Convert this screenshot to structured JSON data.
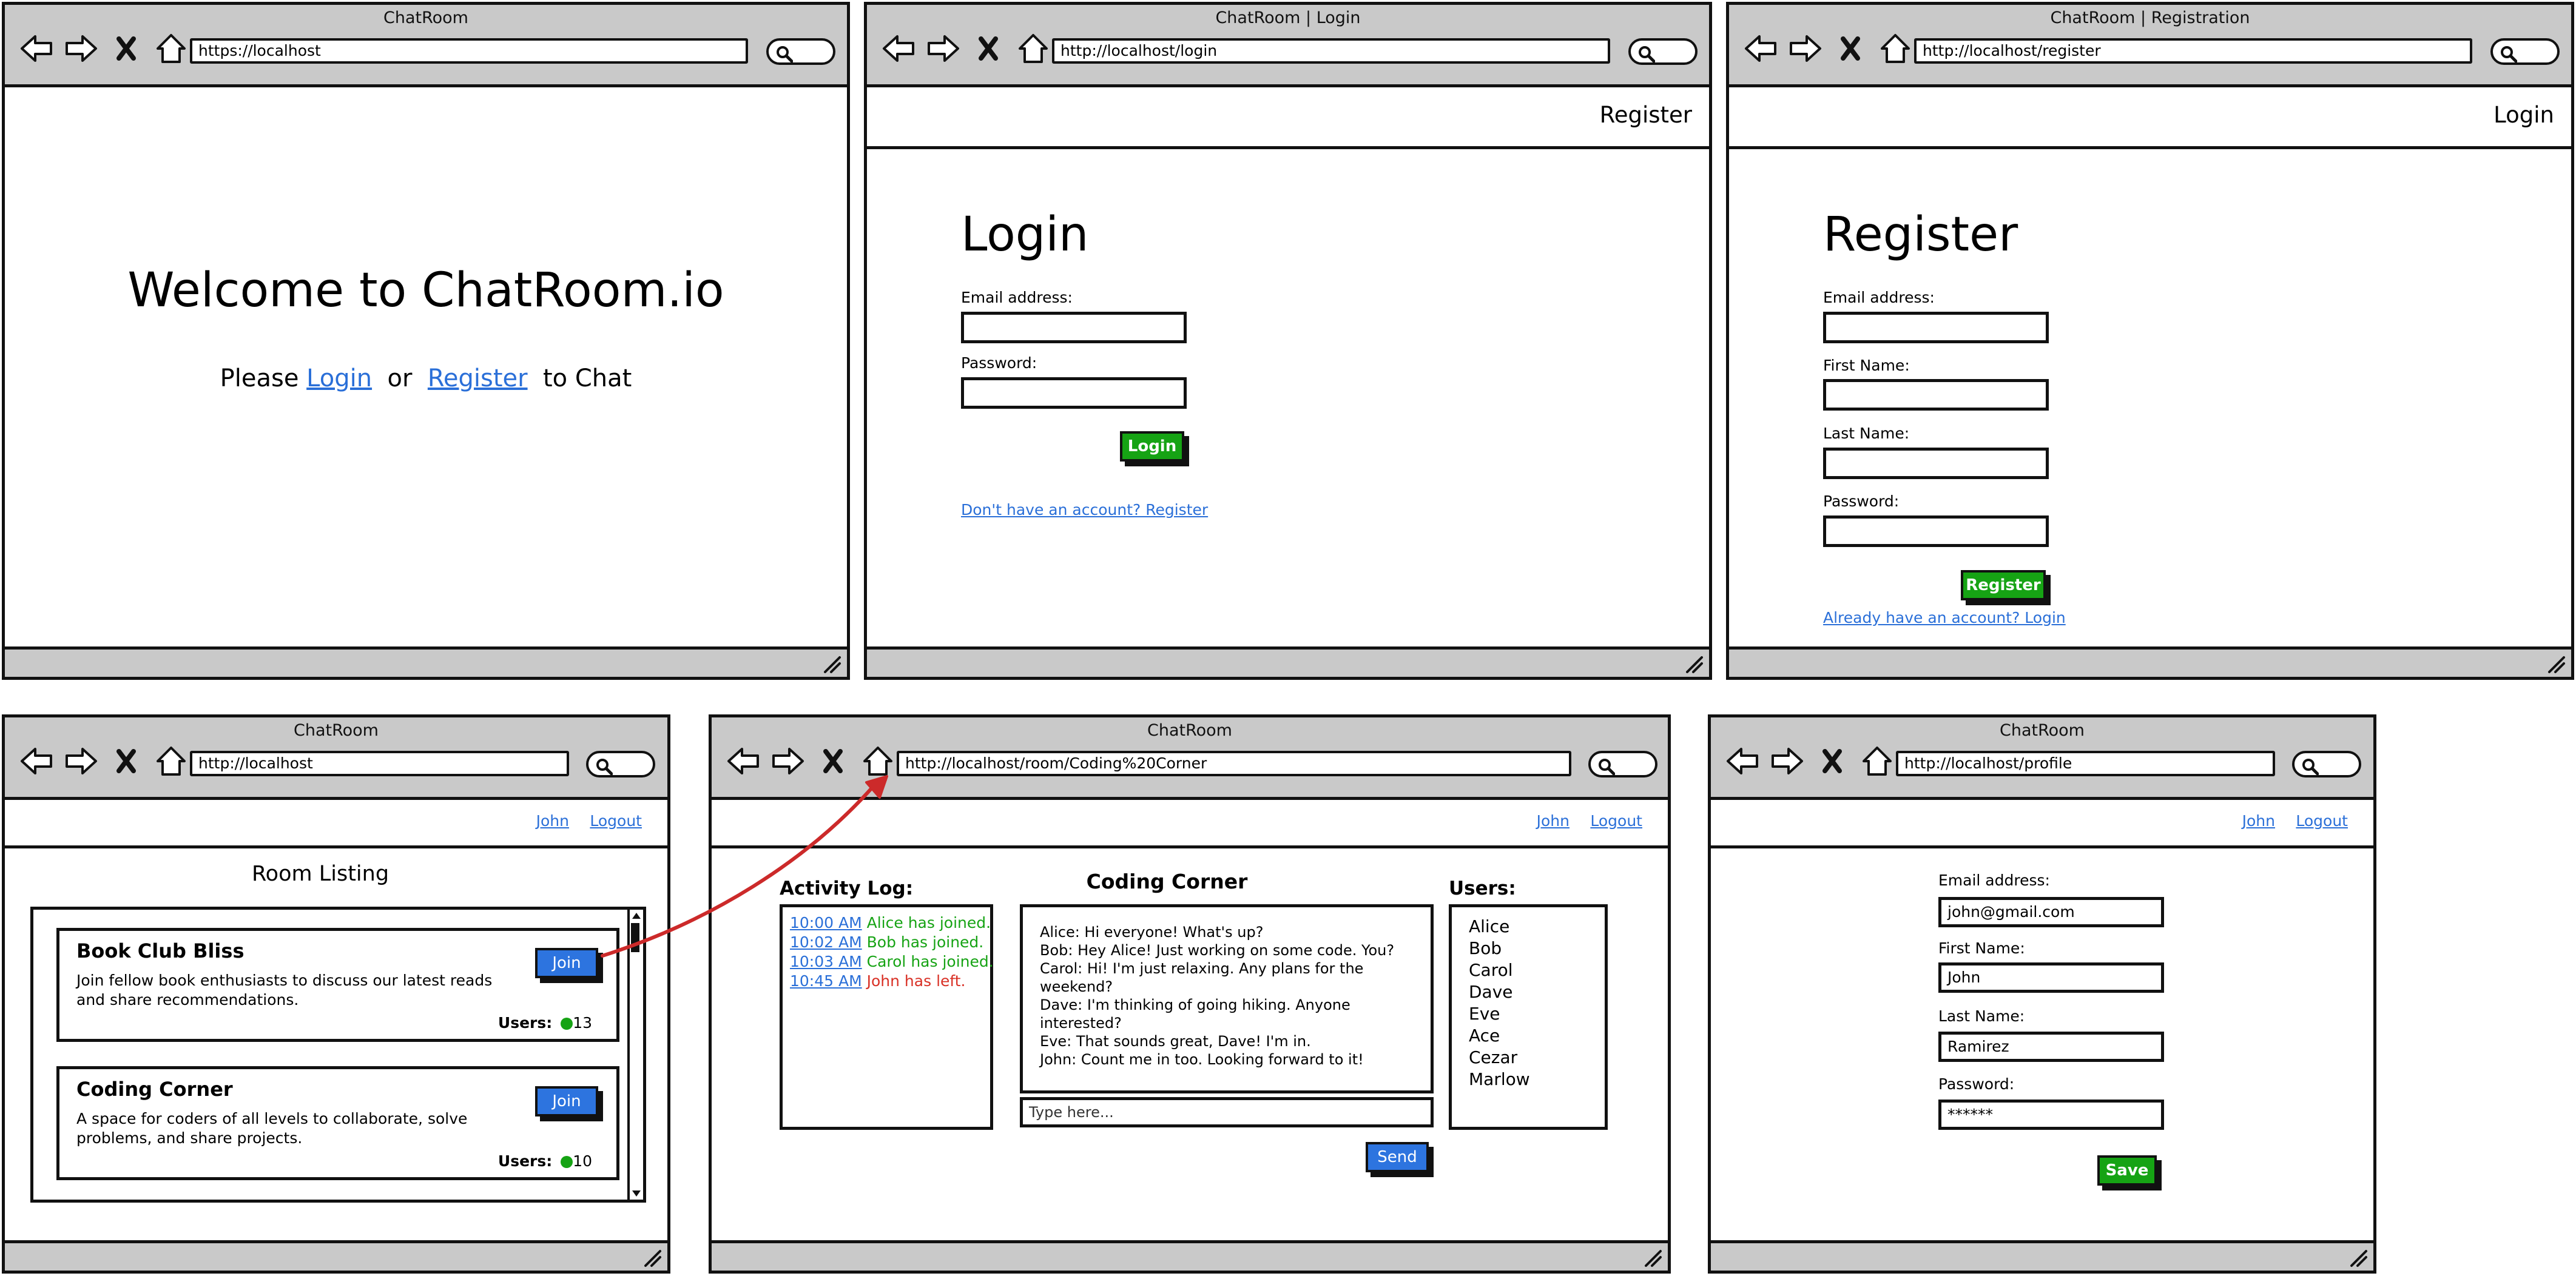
{
  "windows": {
    "welcome": {
      "title": "ChatRoom",
      "url": "https://localhost",
      "heading": "Welcome to ChatRoom.io",
      "prompt_please": "Please",
      "login_link": "Login",
      "prompt_or": "or",
      "register_link": "Register",
      "prompt_end": "to Chat"
    },
    "login": {
      "title": "ChatRoom | Login",
      "url": "http://localhost/login",
      "nav_register": "Register",
      "heading": "Login",
      "email_label": "Email address:",
      "password_label": "Password:",
      "login_button": "Login",
      "register_link": "Don't have an account? Register"
    },
    "register": {
      "title": "ChatRoom | Registration",
      "url": "http://localhost/register",
      "nav_login": "Login",
      "heading": "Register",
      "email_label": "Email address:",
      "first_name_label": "First Name:",
      "last_name_label": "Last Name:",
      "password_label": "Password:",
      "register_button": "Register",
      "login_link": "Already have an account? Login"
    },
    "rooms": {
      "title": "ChatRoom",
      "url": "http://localhost",
      "nav_user": "John",
      "nav_logout": "Logout",
      "heading": "Room Listing",
      "users_label": "Users:",
      "join_label": "Join",
      "cards": [
        {
          "title": "Book Club Bliss",
          "description": "Join fellow book enthusiasts to discuss our latest reads and share recommendations.",
          "count": "13"
        },
        {
          "title": "Coding Corner",
          "description": "A space for coders of all levels to collaborate, solve problems, and share projects.",
          "count": "10"
        }
      ]
    },
    "chat": {
      "title": "ChatRoom",
      "url": "http://localhost/room/Coding%20Corner",
      "nav_user": "John",
      "nav_logout": "Logout",
      "room_title": "Coding Corner",
      "activity_heading": "Activity Log:",
      "users_heading": "Users:",
      "activity": [
        {
          "time": "10:00 AM",
          "text": "Alice has joined.",
          "kind": "join"
        },
        {
          "time": "10:02 AM",
          "text": "Bob has joined.",
          "kind": "join"
        },
        {
          "time": "10:03 AM",
          "text": "Carol has joined.",
          "kind": "join"
        },
        {
          "time": "10:45 AM",
          "text": "John has left.",
          "kind": "leave"
        }
      ],
      "messages": [
        "Alice: Hi everyone! What's up?",
        "Bob: Hey Alice! Just working on some code. You?",
        "Carol: Hi! I'm just relaxing. Any plans for the weekend?",
        "Dave: I'm thinking of going hiking. Anyone interested?",
        "Eve: That sounds great, Dave! I'm in.",
        "John: Count me in too. Looking forward to it!"
      ],
      "input_placeholder": "Type here...",
      "send_button": "Send",
      "users": [
        "Alice",
        "Bob",
        "Carol",
        "Dave",
        "Eve",
        "Ace",
        "Cezar",
        "Marlow"
      ]
    },
    "profile": {
      "title": "ChatRoom",
      "url": "http://localhost/profile",
      "nav_user": "John",
      "nav_logout": "Logout",
      "email_label": "Email address:",
      "email_value": "john@gmail.com",
      "first_name_label": "First Name:",
      "first_name_value": "John",
      "last_name_label": "Last Name:",
      "last_name_value": "Ramirez",
      "password_label": "Password:",
      "password_value": "******",
      "save_button": "Save"
    }
  },
  "colors": {
    "chrome_gray": "#c9c9c9",
    "link_blue": "#2a6fd8",
    "button_green": "#16a314",
    "button_blue": "#2d74df",
    "join_green": "#16a314",
    "leave_red": "#d93025",
    "arrow_red": "#cc2a2a"
  }
}
